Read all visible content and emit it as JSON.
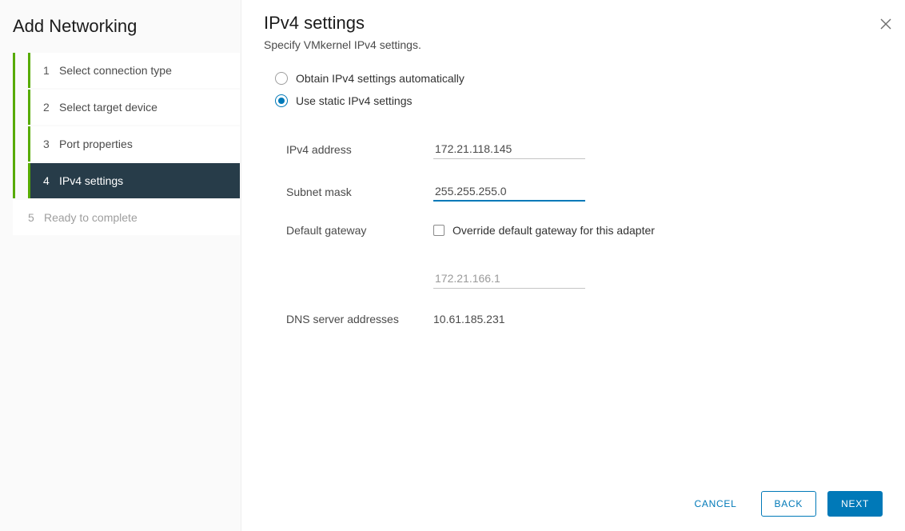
{
  "sidebar": {
    "title": "Add Networking",
    "steps": [
      {
        "num": "1",
        "label": "Select connection type"
      },
      {
        "num": "2",
        "label": "Select target device"
      },
      {
        "num": "3",
        "label": "Port properties"
      },
      {
        "num": "4",
        "label": "IPv4 settings"
      },
      {
        "num": "5",
        "label": "Ready to complete"
      }
    ]
  },
  "main": {
    "title": "IPv4 settings",
    "subtitle": "Specify VMkernel IPv4 settings.",
    "radio_auto": "Obtain IPv4 settings automatically",
    "radio_static": "Use static IPv4 settings",
    "labels": {
      "ipv4_address": "IPv4 address",
      "subnet_mask": "Subnet mask",
      "default_gateway": "Default gateway",
      "dns": "DNS server addresses"
    },
    "values": {
      "ipv4_address": "172.21.118.145",
      "subnet_mask": "255.255.255.0",
      "gateway_checkbox": "Override default gateway for this adapter",
      "gateway_value": "172.21.166.1",
      "dns": "10.61.185.231"
    }
  },
  "footer": {
    "cancel": "CANCEL",
    "back": "BACK",
    "next": "NEXT"
  }
}
